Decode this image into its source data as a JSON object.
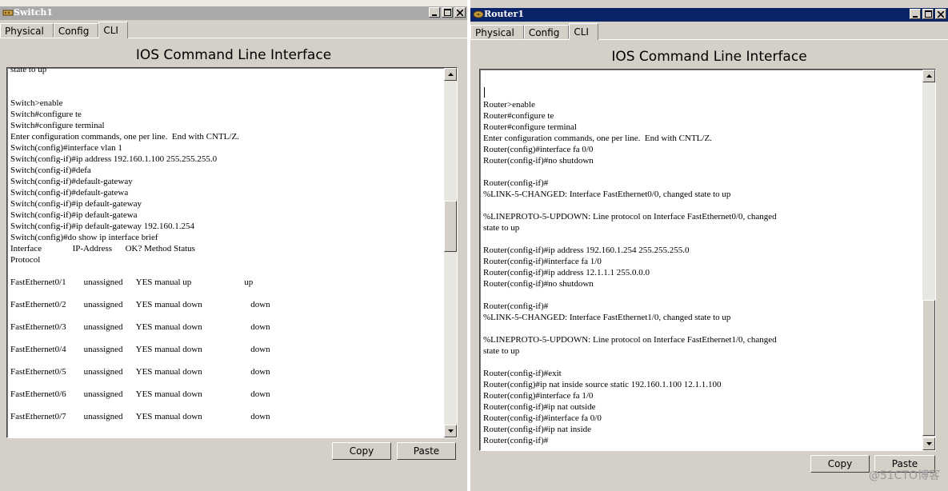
{
  "switch": {
    "title": "Switch1",
    "tabs": [
      "Physical",
      "Config",
      "CLI"
    ],
    "heading": "IOS Command Line Interface",
    "lines": [
      "state to up",
      "",
      "",
      "Switch>enable",
      "Switch#configure te",
      "Switch#configure terminal",
      "Enter configuration commands, one per line.  End with CNTL/Z.",
      "Switch(config)#interface vlan 1",
      "Switch(config-if)#ip address 192.160.1.100 255.255.255.0",
      "Switch(config-if)#defa",
      "Switch(config-if)#default-gateway",
      "Switch(config-if)#default-gatewa",
      "Switch(config-if)#ip default-gateway",
      "Switch(config-if)#ip default-gatewa",
      "Switch(config-if)#ip default-gateway 192.160.1.254",
      "Switch(config)#do show ip interface brief",
      "Interface              IP-Address      OK? Method Status",
      "Protocol",
      "",
      "FastEthernet0/1        unassigned      YES manual up                        up",
      "",
      "FastEthernet0/2        unassigned      YES manual down                      down",
      "",
      "FastEthernet0/3        unassigned      YES manual down                      down",
      "",
      "FastEthernet0/4        unassigned      YES manual down                      down",
      "",
      "FastEthernet0/5        unassigned      YES manual down                      down",
      "",
      "FastEthernet0/6        unassigned      YES manual down                      down",
      "",
      "FastEthernet0/7        unassigned      YES manual down                      down"
    ],
    "copy_label": "Copy",
    "paste_label": "Paste"
  },
  "router": {
    "title": "Router1",
    "tabs": [
      "Physical",
      "Config",
      "CLI"
    ],
    "heading": "IOS Command Line Interface",
    "lines": [
      "",
      "",
      "Router>enable",
      "Router#configure te",
      "Router#configure terminal",
      "Enter configuration commands, one per line.  End with CNTL/Z.",
      "Router(config)#interface fa 0/0",
      "Router(config-if)#no shutdown",
      "",
      "Router(config-if)#",
      "%LINK-5-CHANGED: Interface FastEthernet0/0, changed state to up",
      "",
      "%LINEPROTO-5-UPDOWN: Line protocol on Interface FastEthernet0/0, changed",
      "state to up",
      "",
      "Router(config-if)#ip address 192.160.1.254 255.255.255.0",
      "Router(config-if)#interface fa 1/0",
      "Router(config-if)#ip address 12.1.1.1 255.0.0.0",
      "Router(config-if)#no shutdown",
      "",
      "Router(config-if)#",
      "%LINK-5-CHANGED: Interface FastEthernet1/0, changed state to up",
      "",
      "%LINEPROTO-5-UPDOWN: Line protocol on Interface FastEthernet1/0, changed",
      "state to up",
      "",
      "Router(config-if)#exit",
      "Router(config)#ip nat inside source static 192.160.1.100 12.1.1.100",
      "Router(config)#interface fa 1/0",
      "Router(config-if)#ip nat outside",
      "Router(config-if)#interface fa 0/0",
      "Router(config-if)#ip nat inside",
      "Router(config-if)#"
    ],
    "copy_label": "Copy",
    "paste_label": "Paste"
  },
  "watermark": "@51CTO博客",
  "colors": {
    "active_title": "#0a246a",
    "inactive_title": "#a9a9a9",
    "window_bg": "#d4d0c8"
  }
}
